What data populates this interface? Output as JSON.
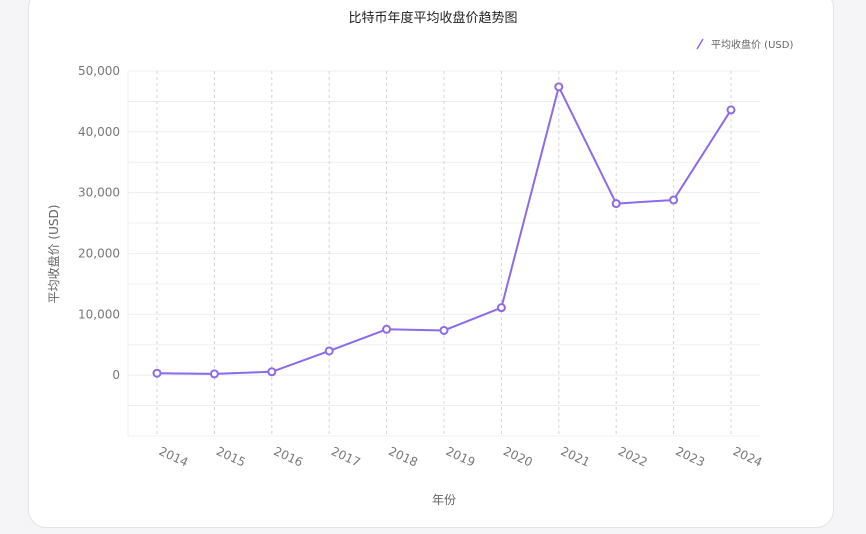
{
  "chart_data": {
    "type": "line",
    "title": "比特币年度平均收盘价趋势图",
    "xlabel": "年份",
    "ylabel": "平均收盘价 (USD)",
    "categories": [
      "2014",
      "2015",
      "2016",
      "2017",
      "2018",
      "2019",
      "2020",
      "2021",
      "2022",
      "2023",
      "2024"
    ],
    "series": [
      {
        "name": "平均收盘价 (USD)",
        "values": [
          320,
          210,
          560,
          3980,
          7540,
          7350,
          11100,
          47400,
          28200,
          28800,
          43600
        ]
      }
    ],
    "ylim": [
      -10000,
      50000
    ],
    "yticks": [
      0,
      10000,
      20000,
      30000,
      40000,
      50000
    ],
    "ytick_labels": [
      "0",
      "10,000",
      "20,000",
      "30,000",
      "40,000",
      "50,000"
    ],
    "legend_position": "top-right",
    "grid": true,
    "colors": {
      "line": "#8b6bea",
      "grid": "#ececec",
      "vertical_grid": "#d4d4d8",
      "text": "#777777"
    }
  }
}
